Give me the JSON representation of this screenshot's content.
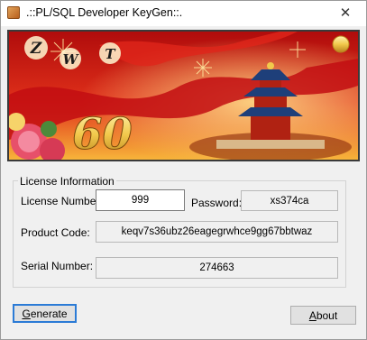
{
  "window": {
    "title": ".::PL/SQL Developer KeyGen::.",
    "close_glyph": "✕"
  },
  "banner": {
    "letters": [
      "Z",
      "W",
      "T"
    ],
    "number": "60",
    "colors": {
      "sky_top": "#c01010",
      "sky_mid": "#e0301a",
      "sky_bottom": "#f7b43a",
      "gold": "#f5d36a"
    }
  },
  "license": {
    "group_label": "License Information",
    "license_number_label": "License Number:",
    "license_number_value": "999",
    "password_label": "Password:",
    "password_value": "xs374ca",
    "product_code_label": "Product Code:",
    "product_code_value": "keqv7s36ubz26eagegrwhce9gg67bbtwaz",
    "serial_number_label": "Serial Number:",
    "serial_number_value": "274663"
  },
  "buttons": {
    "generate_mnemonic": "G",
    "generate_rest": "enerate",
    "about_mnemonic": "A",
    "about_rest": "bout"
  }
}
